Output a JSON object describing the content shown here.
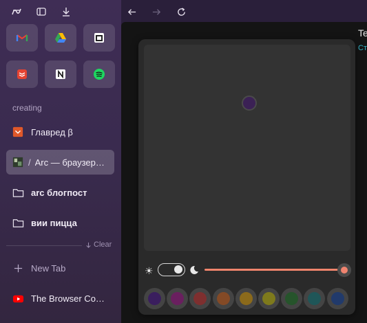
{
  "colors": {
    "accent": "#f08470",
    "link": "#35b6c9",
    "swatches": [
      "#3a1e5e",
      "#6a1f5f",
      "#7e2f2f",
      "#844a26",
      "#8b6a1b",
      "#7e7a1c",
      "#26542b",
      "#1f5658",
      "#213a6b"
    ]
  },
  "toolbar": {
    "icons": [
      "arc-logo-icon",
      "sidebar-toggle-icon",
      "download-icon",
      "back-icon",
      "forward-icon",
      "reload-icon"
    ]
  },
  "favorites": [
    {
      "name": "gmail-icon"
    },
    {
      "name": "google-drive-icon"
    },
    {
      "name": "calendar-icon"
    },
    {
      "name": "todoist-icon"
    },
    {
      "name": "notion-icon"
    },
    {
      "name": "spotify-icon"
    }
  ],
  "sidebar": {
    "section_label": "creating",
    "items": [
      {
        "label": "Главред β",
        "icon": "glavred-icon"
      },
      {
        "label": "Arc — браузер…",
        "prefix": "/",
        "icon": "page-favicon-icon"
      },
      {
        "label": "arc блогпост",
        "icon": "folder-icon"
      },
      {
        "label": "вии пицца",
        "icon": "folder-icon"
      }
    ],
    "clear_label": "Clear",
    "new_tab_label": "New Tab",
    "tab_label": "The Browser Co…"
  },
  "page": {
    "title": "Te",
    "link": "Стı"
  },
  "theme_panel": {
    "mode": "dark",
    "intensity_percent": 100
  }
}
